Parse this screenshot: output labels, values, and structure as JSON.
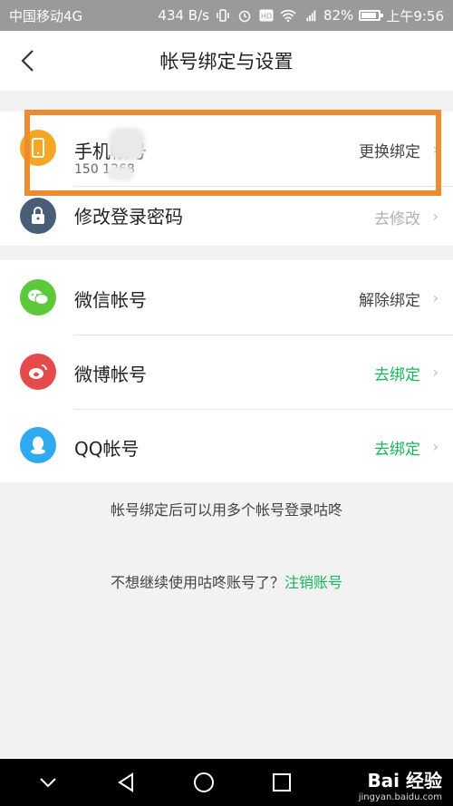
{
  "status": {
    "carrier": "中国移动4G",
    "speed": "434 B/s",
    "signal_label": "4G",
    "battery": "82%",
    "time": "上午9:56"
  },
  "header": {
    "title": "帐号绑定与设置"
  },
  "account_section": {
    "phone": {
      "label": "手机帐号",
      "number": "150 1268",
      "action": "更换绑定"
    },
    "password": {
      "label": "修改登录密码",
      "action": "去修改"
    }
  },
  "social_section": {
    "wechat": {
      "label": "微信帐号",
      "action": "解除绑定"
    },
    "weibo": {
      "label": "微博帐号",
      "action": "去绑定"
    },
    "qq": {
      "label": "QQ帐号",
      "action": "去绑定"
    }
  },
  "tips": {
    "bind_tip": "帐号绑定后可以用多个帐号登录咕咚",
    "cancel_prefix": "不想继续使用咕咚账号了？",
    "cancel_link": "注销账号"
  },
  "watermark": {
    "main": "Bai 经验",
    "small": "jingyan.baidu.com"
  },
  "colors": {
    "accent_green": "#19b55b",
    "highlight_orange": "#ef8a2e",
    "phone_icon": "#f5a623",
    "lock_icon": "#4a5d77",
    "wechat_icon": "#5cc83b",
    "weibo_icon": "#e64b4b",
    "qq_icon": "#2eaaf0"
  }
}
